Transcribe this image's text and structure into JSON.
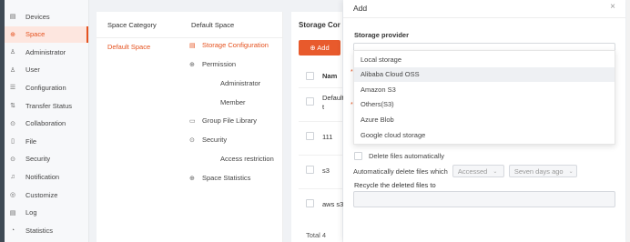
{
  "sidebar": {
    "items": [
      {
        "label": "Devices",
        "icon": "devices-icon",
        "glyph": "▤",
        "active": false
      },
      {
        "label": "Space",
        "icon": "space-icon",
        "glyph": "⊕",
        "active": true
      },
      {
        "label": "Administrator",
        "icon": "administrator-icon",
        "glyph": "♙",
        "active": false
      },
      {
        "label": "User",
        "icon": "user-icon",
        "glyph": "♙",
        "active": false
      },
      {
        "label": "Configuration",
        "icon": "configuration-icon",
        "glyph": "☰",
        "active": false
      },
      {
        "label": "Transfer Status",
        "icon": "transfer-icon",
        "glyph": "⇅",
        "active": false
      },
      {
        "label": "Collaboration",
        "icon": "collaboration-icon",
        "glyph": "⊙",
        "active": false
      },
      {
        "label": "File",
        "icon": "file-icon",
        "glyph": "▯",
        "active": false
      },
      {
        "label": "Security",
        "icon": "security-icon",
        "glyph": "⊙",
        "active": false
      },
      {
        "label": "Notification",
        "icon": "notification-icon",
        "glyph": "♫",
        "active": false
      },
      {
        "label": "Customize",
        "icon": "customize-icon",
        "glyph": "◎",
        "active": false
      },
      {
        "label": "Log",
        "icon": "log-icon",
        "glyph": "▤",
        "active": false
      },
      {
        "label": "Statistics",
        "icon": "statistics-icon",
        "glyph": "◔",
        "active": false
      }
    ]
  },
  "space_category": {
    "header": "Space Category",
    "items": [
      "Default Space"
    ]
  },
  "space_menu": {
    "header": "Default Space",
    "storage_configuration": "Storage Configuration",
    "permission": "Permission",
    "administrator": "Administrator",
    "member": "Member",
    "group_file_library": "Group File Library",
    "security": "Security",
    "access_restriction": "Access restriction",
    "space_statistics": "Space Statistics"
  },
  "storage": {
    "title": "Storage Cor",
    "add_button": "⊕ Add",
    "col_name": "Nam",
    "rows": [
      "Default",
      "t",
      "111",
      "s3",
      "aws s3"
    ],
    "total": "Total 4"
  },
  "panel": {
    "title": "Add",
    "close": "×",
    "provider_label": "Storage provider",
    "options": [
      "Local storage",
      "Alibaba Cloud OSS",
      "Amazon S3",
      "Others(S3)",
      "Azure Blob",
      "Google cloud storage"
    ],
    "highlighted_index": 1,
    "delete_files_auto": "Delete files automatically",
    "auto_delete_label": "Automatically delete files which",
    "accessed_value": "Accessed",
    "days_value": "Seven days ago",
    "recycle_label": "Recycle the deleted files to"
  }
}
